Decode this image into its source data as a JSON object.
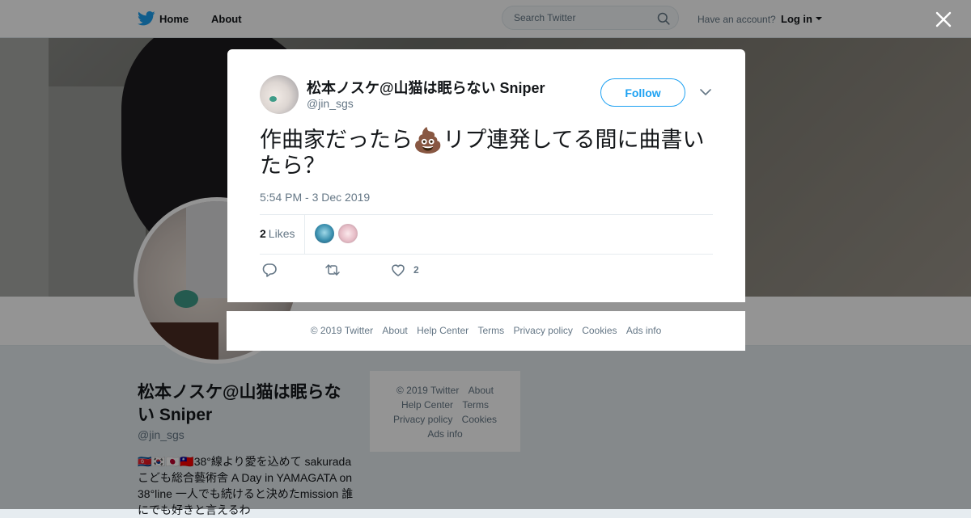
{
  "nav": {
    "home_label": "Home",
    "about_label": "About",
    "search_placeholder": "Search Twitter",
    "have_account": "Have an account?",
    "login_label": "Log in"
  },
  "profile": {
    "name": "松本ノスケ@山猫は眠らない Sniper",
    "handle": "@jin_sgs",
    "bio": "🇰🇵🇰🇷🇯🇵🇹🇼38°線より愛を込めて sakuradaこども総合藝術舎 A Day in YAMAGATA on 38°line 一人でも続けると決めたmission 誰にでも好きと言えるわ"
  },
  "side_footer": {
    "links": [
      "© 2019 Twitter",
      "About",
      "Help Center",
      "Terms",
      "Privacy policy",
      "Cookies",
      "Ads info"
    ]
  },
  "tweet": {
    "author_name": "松本ノスケ@山猫は眠らない Sniper",
    "author_handle": "@jin_sgs",
    "follow_label": "Follow",
    "text_before": "作曲家だったら",
    "emoji": "💩",
    "text_after": "リプ連発してる間に曲書いたら？",
    "timestamp": "5:54 PM - 3 Dec 2019",
    "likes_count": "2",
    "likes_label": "Likes",
    "like_action_count": "2"
  },
  "modal_footer": {
    "links": [
      "© 2019 Twitter",
      "About",
      "Help Center",
      "Terms",
      "Privacy policy",
      "Cookies",
      "Ads info"
    ]
  },
  "colors": {
    "brand": "#1da1f2",
    "text_primary": "#14171a",
    "text_secondary": "#657786",
    "border": "#e6ecf0"
  },
  "icons": [
    "twitter-bird-icon",
    "search-icon",
    "caret-down-icon",
    "close-icon",
    "chevron-down-icon",
    "reply-icon",
    "retweet-icon",
    "heart-icon"
  ]
}
